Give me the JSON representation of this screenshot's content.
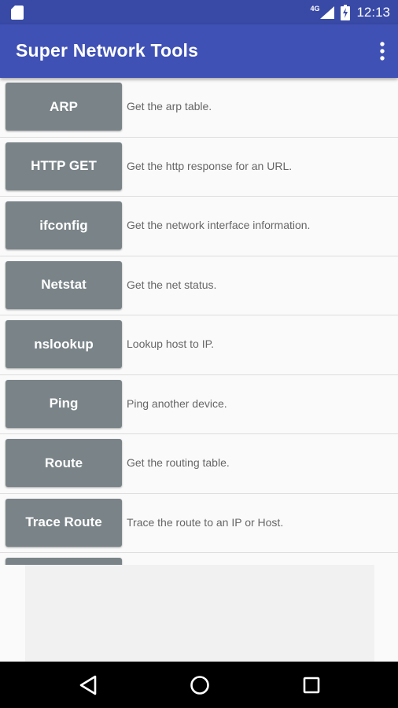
{
  "status_bar": {
    "network_type": "4G",
    "time": "12:13",
    "icons": [
      "sim-card-icon",
      "signal-icon",
      "battery-charging-icon"
    ]
  },
  "app_bar": {
    "title": "Super Network Tools",
    "menu_icon": "overflow-menu-icon"
  },
  "tools": [
    {
      "label": "ARP",
      "description": "Get the arp table."
    },
    {
      "label": "HTTP GET",
      "description": "Get the http response for an URL."
    },
    {
      "label": "ifconfig",
      "description": "Get the network interface information."
    },
    {
      "label": "Netstat",
      "description": "Get the net status."
    },
    {
      "label": "nslookup",
      "description": "Lookup host to IP."
    },
    {
      "label": "Ping",
      "description": "Ping another device."
    },
    {
      "label": "Route",
      "description": "Get the routing table."
    },
    {
      "label": "Trace Route",
      "description": "Trace the route to an IP or Host."
    },
    {
      "label": "",
      "description": ""
    }
  ],
  "nav_bar": {
    "icons": [
      "back-icon",
      "home-icon",
      "recents-icon"
    ]
  },
  "colors": {
    "status_bar": "#3849a6",
    "app_bar": "#3f51b5",
    "button": "#7a8488",
    "background": "#fafafa"
  }
}
